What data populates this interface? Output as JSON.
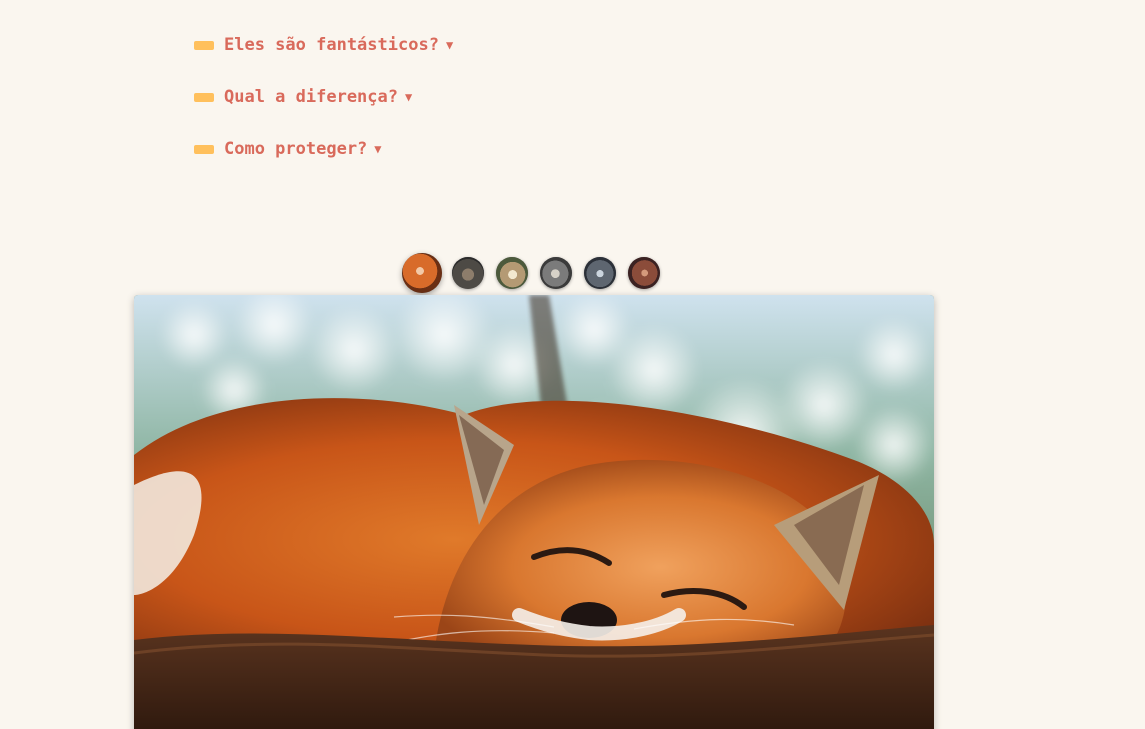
{
  "faq": {
    "items": [
      {
        "label": "Eles são fantásticos?",
        "caret": "▼"
      },
      {
        "label": "Qual a diferença?",
        "caret": "▼"
      },
      {
        "label": "Como proteger?",
        "caret": "▼"
      }
    ]
  },
  "gallery": {
    "selected_index": 0,
    "thumbnails": [
      {
        "icon": "fox-thumbnail"
      },
      {
        "icon": "animal-thumbnail-2"
      },
      {
        "icon": "bear-thumbnail"
      },
      {
        "icon": "wolf-thumbnail"
      },
      {
        "icon": "animal-thumbnail-5"
      },
      {
        "icon": "animal-thumbnail-6"
      }
    ]
  },
  "colors": {
    "background": "#faf6ef",
    "faq_text": "#d96a5b",
    "faq_bar": "#ffc05c"
  }
}
